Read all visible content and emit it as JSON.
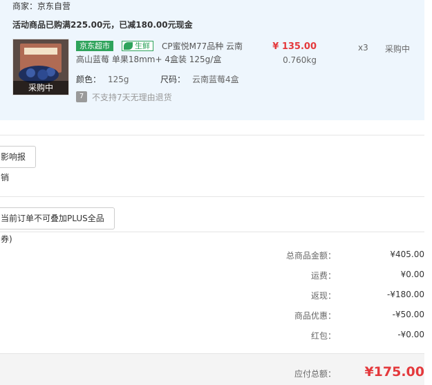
{
  "store": {
    "merchant_label": "商家：京东自营",
    "promo_text": "活动商品已购满225.00元，已减180.00元现金"
  },
  "item": {
    "thumb_overlay": "采购中",
    "tag_jd": "京东超市",
    "tag_fresh": "生鲜",
    "title": "CP蜜悦M77品种 云南高山蓝莓 单果18mm+ 4盒装 125g/盒",
    "price": "¥ 135.00",
    "weight": "0.760kg",
    "quantity": "x3",
    "status": "采购中",
    "color_label": "颜色：",
    "color_value": "125g",
    "size_label": "尺码：",
    "size_value": "云南蓝莓4盒",
    "return_icon": "7",
    "return_text": "不支持7天无理由退货"
  },
  "invoice": {
    "label": "影响报销"
  },
  "coupon": {
    "label": "当前订单不可叠加PLUS全品券)"
  },
  "summary": [
    {
      "label": "总商品金额：",
      "value": "¥405.00"
    },
    {
      "label": "运费：",
      "value": "¥0.00"
    },
    {
      "label": "返现：",
      "value": "-¥180.00"
    },
    {
      "label": "商品优惠：",
      "value": "-¥50.00"
    },
    {
      "label": "红包：",
      "value": "-¥0.00"
    }
  ],
  "payment": {
    "label": "应付总额：",
    "total": "¥175.00"
  },
  "colors": {
    "price_red": "#e4393c",
    "panel_bg": "#eef6fd",
    "tag_green": "#2ea35b"
  }
}
